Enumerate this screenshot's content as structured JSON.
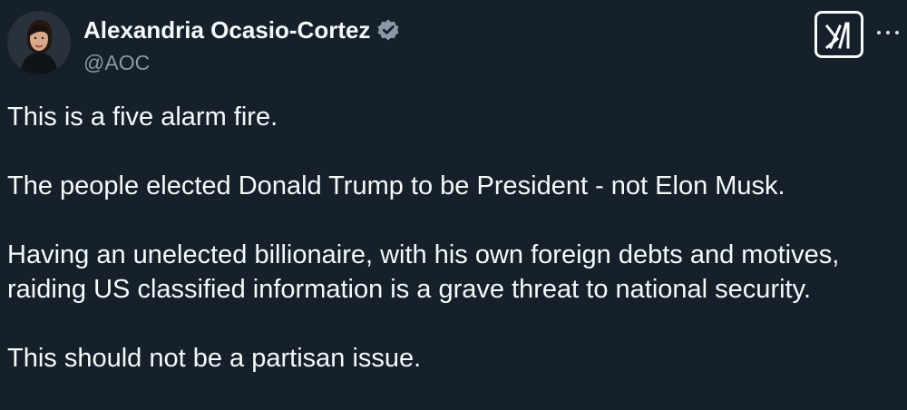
{
  "tweet": {
    "author": {
      "name": "Alexandria Ocasio-Cortez",
      "handle": "@AOC",
      "avatar_icon": "profile-photo",
      "verified_icon": "verified-badge-icon"
    },
    "body": {
      "paragraph_1": "This is a five alarm fire.",
      "paragraph_2": "The people elected Donald Trump to be President - not Elon Musk.",
      "paragraph_3": "Having an unelected billionaire, with his own foreign debts and motives,\nraiding US classified information is a grave threat to national security.",
      "paragraph_4": "This should not be a partisan issue."
    },
    "controls": {
      "platform_icon": "x-grok-logo-icon",
      "more_icon": "more-options-icon"
    },
    "colors": {
      "background": "#15202b",
      "text": "#f7f9f9",
      "secondary_text": "#8b98a5",
      "verified_badge": "#8b98a5"
    }
  }
}
